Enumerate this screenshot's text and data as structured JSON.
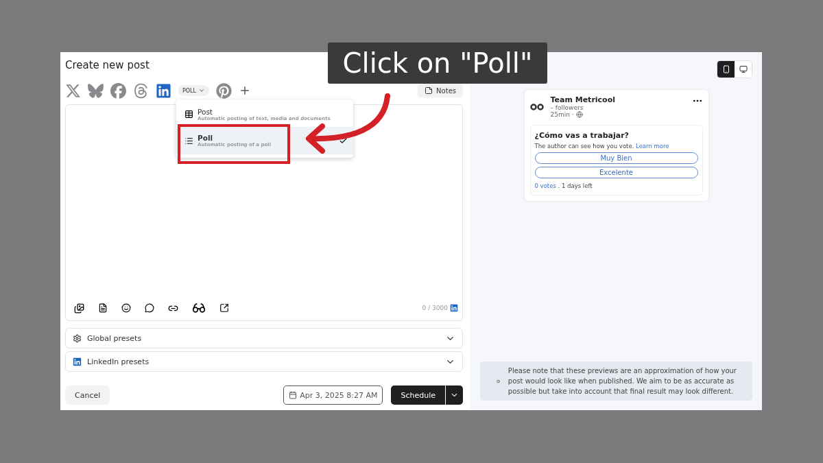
{
  "callout": {
    "text": "Click on \"Poll\""
  },
  "title": "Create new post",
  "networks": [
    {
      "kind": "x",
      "selected": false
    },
    {
      "kind": "bluesky",
      "selected": false
    },
    {
      "kind": "facebook",
      "selected": false
    },
    {
      "kind": "threads",
      "selected": false
    },
    {
      "kind": "linkedin",
      "selected": true
    },
    {
      "kind": "pinterest",
      "selected": false
    }
  ],
  "post_type": {
    "label": "POLL"
  },
  "menu": {
    "items": [
      {
        "kind": "post",
        "title": "Post",
        "subtitle": "Automatic posting of text, media and documents",
        "selected": false
      },
      {
        "kind": "poll",
        "title": "Poll",
        "subtitle": "Automatic posting of a poll",
        "selected": true
      }
    ]
  },
  "notes_button": "Notes",
  "counter": "0 / 3000",
  "presets": [
    {
      "kind": "global",
      "label": "Global presets"
    },
    {
      "kind": "linkedin",
      "label": "LinkedIn presets"
    }
  ],
  "cancel": "Cancel",
  "date": "Apr 3, 2025 8:27 AM",
  "schedule": "Schedule",
  "preview": {
    "views": [
      {
        "kind": "mobile",
        "selected": true
      },
      {
        "kind": "desktop",
        "selected": false
      }
    ],
    "author": "Team Metricool",
    "followers": "– followers",
    "time": "25min ·",
    "question": "¿Cómo vas a trabajar?",
    "note": "The author can see how you vote.",
    "learn_more": "Learn more",
    "options": [
      "Muy Bien",
      "Excelente"
    ],
    "votes": "0 votes",
    "days_left": ". 1 days left"
  },
  "disclaimer": "Please note that these previews are an approximation of how your post would look like when published. We aim to be as accurate as possible but take into account that final result may look different."
}
